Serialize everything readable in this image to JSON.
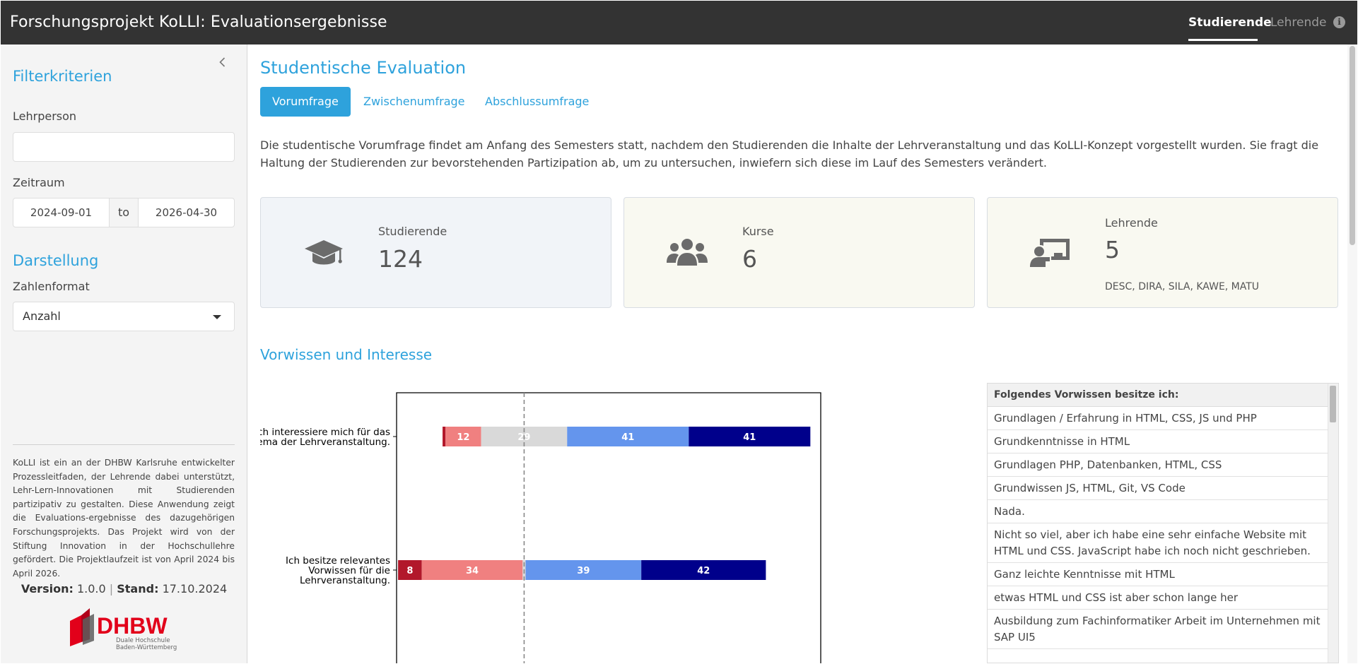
{
  "header": {
    "title": "Forschungsprojekt KoLLI: Evaluationsergebnisse",
    "nav": [
      "Studierende",
      "Lehrende"
    ],
    "active_nav": "Studierende",
    "info_icon": "info-circle-icon"
  },
  "sidebar": {
    "collapse_icon": "chevron-left-icon",
    "filter_heading": "Filterkriterien",
    "lehrperson_label": "Lehrperson",
    "lehrperson_value": "",
    "zeitraum_label": "Zeitraum",
    "date_from": "2024-09-01",
    "date_separator": "to",
    "date_to": "2026-04-30",
    "display_heading": "Darstellung",
    "format_label": "Zahlenformat",
    "format_value": "Anzahl",
    "about": "KoLLI ist ein an der DHBW Karlsruhe entwickelter Prozessleitfaden, der Lehrende dabei unterstützt, Lehr-Lern-Innovationen mit Studierenden partizipativ zu gestalten. Diese Anwendung zeigt die Evaluations-ergebnisse des dazugehörigen Forschungsprojekts. Das Projekt wird von der Stiftung Innovation in der Hochschullehre gefördert. Die Projektlaufzeit ist von April 2024 bis April 2026.",
    "version_label": "Version:",
    "version_value": "1.0.0",
    "version_separator": "|",
    "stand_label": "Stand:",
    "stand_value": "17.10.2024",
    "logo": {
      "wordmark": "DHBW",
      "line1": "Duale Hochschule",
      "line2": "Baden-Württemberg"
    }
  },
  "main": {
    "title": "Studentische Evaluation",
    "tabs": [
      "Vorumfrage",
      "Zwischenumfrage",
      "Abschlussumfrage"
    ],
    "active_tab": "Vorumfrage",
    "intro": "Die studentische Vorumfrage findet am Anfang des Semesters statt, nachdem den Studierenden die Inhalte der Lehrveranstaltung und das KoLLI-Konzept vorgestellt wurden. Sie fragt die Haltung der Studierenden zur bevorstehenden Partizipation ab, um zu untersuchen, inwiefern sich diese im Lauf des Semesters verändert.",
    "cards": [
      {
        "icon": "graduation-cap-icon",
        "label": "Studierende",
        "value": "124",
        "sub": "",
        "bg": "#f1f4f8"
      },
      {
        "icon": "users-icon",
        "label": "Kurse",
        "value": "6",
        "sub": "",
        "bg": "#f9f9f1"
      },
      {
        "icon": "chalkboard-teacher-icon",
        "label": "Lehrende",
        "value": "5",
        "sub": "DESC, DIRA, SILA, KAWE, MATU",
        "bg": "#f9f9f1"
      }
    ],
    "section_title": "Vorwissen und Interesse",
    "table": {
      "header": "Folgendes Vorwissen besitze ich:",
      "rows": [
        "Grundlagen / Erfahrung in HTML, CSS, JS und PHP",
        "Grundkenntnisse in HTML",
        "Grundlagen PHP, Datenbanken, HTML, CSS",
        "Grundwissen JS, HTML, Git, VS Code",
        "Nada.",
        "Nicht so viel, aber ich habe eine sehr einfache Website mit HTML und CSS. JavaScript habe ich noch nicht geschrieben.",
        "Ganz leichte Kenntnisse mit HTML",
        "etwas HTML und CSS ist aber schon lange her",
        "Ausbildung zum Fachinformatiker Arbeit im Unternehmen mit SAP UI5"
      ]
    }
  },
  "chart_data": {
    "type": "bar",
    "orientation": "horizontal",
    "stacked": true,
    "diverging": true,
    "categories": [
      "Ich interessiere mich für das Thema der Lehrveranstaltung.",
      "Ich besitze relevantes Vorwissen für die Lehrveranstaltung."
    ],
    "category_lines": [
      [
        "Ich interessiere mich für das",
        "Thema der Lehrveranstaltung."
      ],
      [
        "Ich besitze relevantes",
        "Vorwissen für die",
        "Lehrveranstaltung."
      ]
    ],
    "series": [
      {
        "color": "#b2182b",
        "values": [
          1,
          8
        ],
        "labels": [
          "",
          "8"
        ]
      },
      {
        "color": "#f08080",
        "values": [
          12,
          34
        ],
        "labels": [
          "12",
          "34"
        ]
      },
      {
        "color": "#d9d9d9",
        "values": [
          29,
          1
        ],
        "labels": [
          "29",
          ""
        ]
      },
      {
        "color": "#6495ed",
        "values": [
          41,
          39
        ],
        "labels": [
          "41",
          "39"
        ]
      },
      {
        "color": "#00008b",
        "values": [
          41,
          42
        ],
        "labels": [
          "41",
          "42"
        ]
      }
    ],
    "xlim": [
      -43,
      100
    ],
    "center_line": 0,
    "grid": false,
    "legend": "none"
  }
}
